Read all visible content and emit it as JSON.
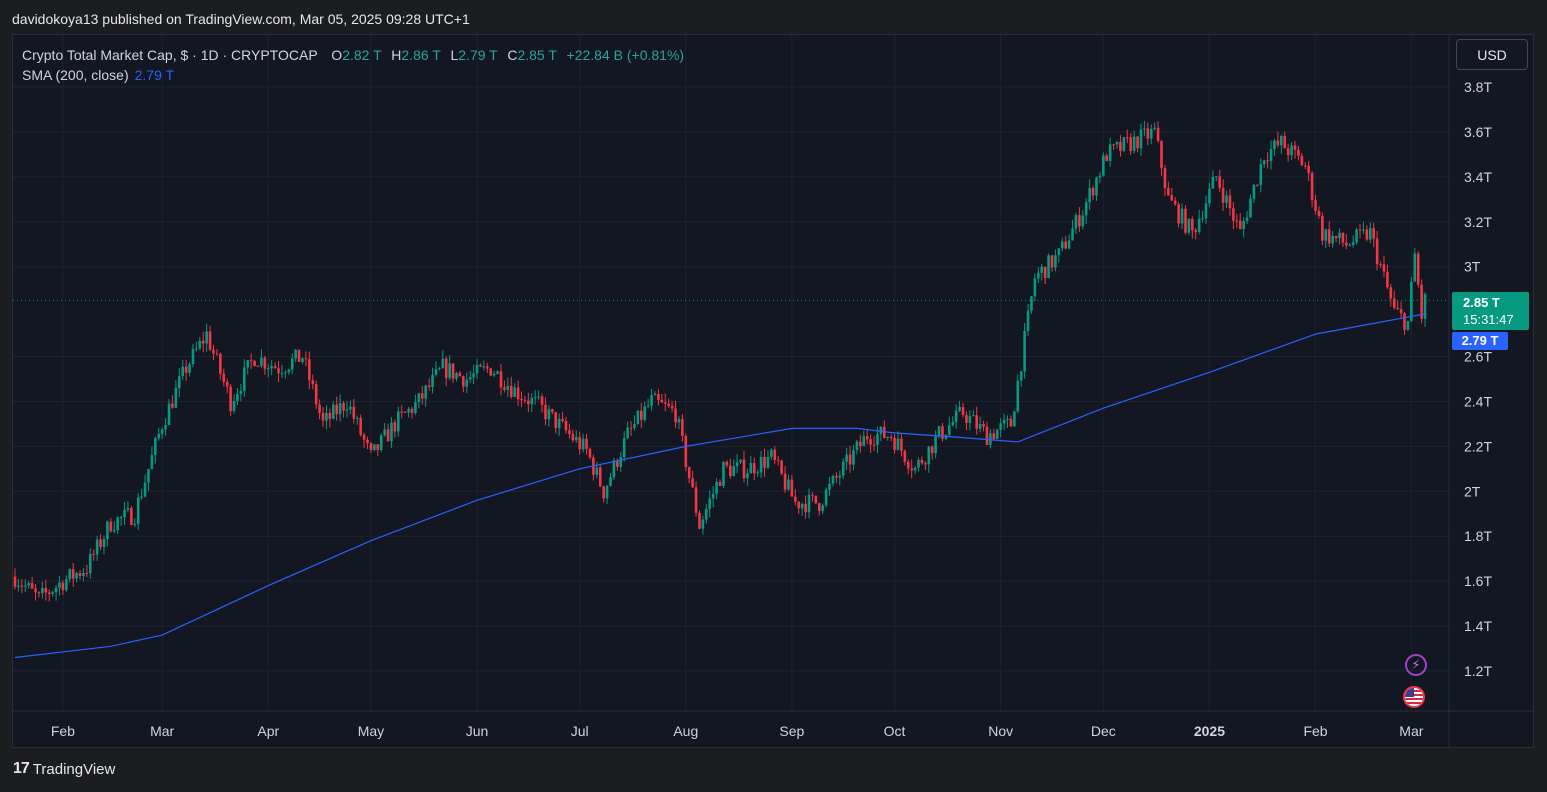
{
  "header": {
    "publisher_line": "davidokoya13 published on TradingView.com, Mar 05, 2025 09:28 UTC+1"
  },
  "legend": {
    "symbol": "Crypto Total Market Cap, $ · 1D · CRYPTOCAP",
    "o_label": "O",
    "o_value": "2.82 T",
    "h_label": "H",
    "h_value": "2.86 T",
    "l_label": "L",
    "l_value": "2.79 T",
    "c_label": "C",
    "c_value": "2.85 T",
    "change": "+22.84 B (+0.81%)",
    "sma_label": "SMA (200, close)",
    "sma_value": "2.79 T"
  },
  "toolbar": {
    "currency_button": "USD"
  },
  "badges": {
    "price": "2.85 T",
    "countdown": "15:31:47",
    "sma": "2.79 T"
  },
  "footer": {
    "brand": "TradingView",
    "brand_mark": "17"
  },
  "colors": {
    "up": "#089981",
    "down": "#f23645",
    "sma": "#2962ff",
    "bg": "#131722",
    "grid": "#1f2330"
  },
  "chart_data": {
    "type": "candlestick",
    "title": "Crypto Total Market Cap, $ · 1D · CRYPTOCAP",
    "ylabel": "",
    "xlabel": "",
    "y_unit": "T",
    "ylim": [
      1.1,
      3.88
    ],
    "y_ticks": [
      "3.8T",
      "3.6T",
      "3.4T",
      "3.2T",
      "3T",
      "2.6T",
      "2.4T",
      "2.2T",
      "2T",
      "1.8T",
      "1.6T",
      "1.4T",
      "1.2T"
    ],
    "y_tick_values": [
      3.8,
      3.6,
      3.4,
      3.2,
      3.0,
      2.6,
      2.4,
      2.2,
      2.0,
      1.8,
      1.6,
      1.4,
      1.2
    ],
    "x_ticks": [
      "Feb",
      "Mar",
      "Apr",
      "May",
      "Jun",
      "Jul",
      "Aug",
      "Sep",
      "Oct",
      "Nov",
      "Dec",
      "2025",
      "Feb",
      "Mar"
    ],
    "x_tick_dates": [
      "2024-02-01",
      "2024-03-01",
      "2024-04-01",
      "2024-05-01",
      "2024-06-01",
      "2024-07-01",
      "2024-08-01",
      "2024-09-01",
      "2024-10-01",
      "2024-11-01",
      "2024-12-01",
      "2025-01-01",
      "2025-02-01",
      "2025-03-01"
    ],
    "x_range": [
      "2024-01-18",
      "2025-03-12"
    ],
    "price_line": 2.85,
    "grid": true,
    "series": [
      {
        "name": "Crypto Total Market Cap",
        "kind": "close",
        "points": [
          [
            "2024-01-18",
            1.62
          ],
          [
            "2024-01-25",
            1.52
          ],
          [
            "2024-02-01",
            1.6
          ],
          [
            "2024-02-08",
            1.66
          ],
          [
            "2024-02-15",
            1.86
          ],
          [
            "2024-02-22",
            1.9
          ],
          [
            "2024-03-01",
            2.3
          ],
          [
            "2024-03-08",
            2.55
          ],
          [
            "2024-03-14",
            2.7
          ],
          [
            "2024-03-21",
            2.4
          ],
          [
            "2024-03-28",
            2.6
          ],
          [
            "2024-04-04",
            2.55
          ],
          [
            "2024-04-11",
            2.6
          ],
          [
            "2024-04-17",
            2.3
          ],
          [
            "2024-04-24",
            2.4
          ],
          [
            "2024-05-01",
            2.15
          ],
          [
            "2024-05-08",
            2.3
          ],
          [
            "2024-05-15",
            2.4
          ],
          [
            "2024-05-22",
            2.55
          ],
          [
            "2024-05-29",
            2.5
          ],
          [
            "2024-06-05",
            2.55
          ],
          [
            "2024-06-12",
            2.45
          ],
          [
            "2024-06-19",
            2.38
          ],
          [
            "2024-06-26",
            2.28
          ],
          [
            "2024-07-03",
            2.18
          ],
          [
            "2024-07-08",
            2.0
          ],
          [
            "2024-07-15",
            2.25
          ],
          [
            "2024-07-22",
            2.4
          ],
          [
            "2024-07-29",
            2.35
          ],
          [
            "2024-08-05",
            1.85
          ],
          [
            "2024-08-12",
            2.1
          ],
          [
            "2024-08-19",
            2.1
          ],
          [
            "2024-08-26",
            2.15
          ],
          [
            "2024-09-02",
            1.95
          ],
          [
            "2024-09-09",
            1.95
          ],
          [
            "2024-09-16",
            2.1
          ],
          [
            "2024-09-23",
            2.25
          ],
          [
            "2024-09-30",
            2.25
          ],
          [
            "2024-10-07",
            2.1
          ],
          [
            "2024-10-14",
            2.25
          ],
          [
            "2024-10-21",
            2.35
          ],
          [
            "2024-10-28",
            2.25
          ],
          [
            "2024-11-04",
            2.3
          ],
          [
            "2024-11-11",
            2.95
          ],
          [
            "2024-11-18",
            3.05
          ],
          [
            "2024-11-25",
            3.25
          ],
          [
            "2024-12-02",
            3.5
          ],
          [
            "2024-12-09",
            3.55
          ],
          [
            "2024-12-16",
            3.6
          ],
          [
            "2024-12-20",
            3.3
          ],
          [
            "2024-12-27",
            3.15
          ],
          [
            "2025-01-03",
            3.4
          ],
          [
            "2025-01-10",
            3.15
          ],
          [
            "2025-01-17",
            3.5
          ],
          [
            "2025-01-22",
            3.55
          ],
          [
            "2025-01-29",
            3.45
          ],
          [
            "2025-02-03",
            3.15
          ],
          [
            "2025-02-10",
            3.1
          ],
          [
            "2025-02-17",
            3.15
          ],
          [
            "2025-02-24",
            2.8
          ],
          [
            "2025-02-28",
            2.75
          ],
          [
            "2025-03-02",
            3.05
          ],
          [
            "2025-03-04",
            2.78
          ],
          [
            "2025-03-05",
            2.85
          ]
        ]
      },
      {
        "name": "SMA (200, close)",
        "points": [
          [
            "2024-01-18",
            1.26
          ],
          [
            "2024-02-15",
            1.31
          ],
          [
            "2024-03-01",
            1.36
          ],
          [
            "2024-04-01",
            1.58
          ],
          [
            "2024-05-01",
            1.78
          ],
          [
            "2024-06-01",
            1.96
          ],
          [
            "2024-07-01",
            2.1
          ],
          [
            "2024-08-01",
            2.2
          ],
          [
            "2024-09-01",
            2.28
          ],
          [
            "2024-09-20",
            2.28
          ],
          [
            "2024-10-01",
            2.26
          ],
          [
            "2024-10-20",
            2.24
          ],
          [
            "2024-11-06",
            2.22
          ],
          [
            "2024-12-01",
            2.37
          ],
          [
            "2025-01-01",
            2.53
          ],
          [
            "2025-02-01",
            2.7
          ],
          [
            "2025-03-05",
            2.79
          ]
        ]
      }
    ]
  }
}
